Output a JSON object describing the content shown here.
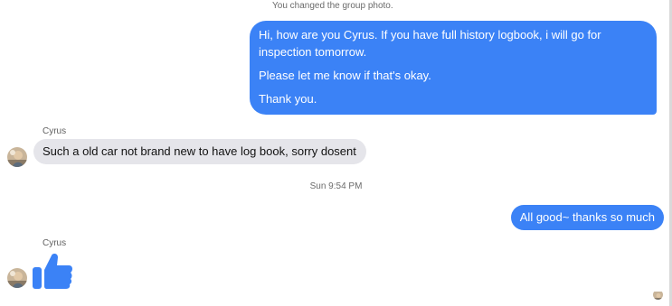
{
  "system_note": "You changed the group photo.",
  "messages": {
    "outgoing_long": [
      "Hi, how are you Cyrus. If you have full history logbook, i will go for inspection tomorrow.",
      "Please let me know if that's okay.",
      "Thank you."
    ],
    "incoming_sender": "Cyrus",
    "incoming_text": "Such a old car not brand new to have log book, sorry dosent",
    "timestamp": "Sun 9:54 PM",
    "outgoing_short": "All good~ thanks so much",
    "incoming_sender_2": "Cyrus",
    "incoming_reaction_icon": "thumbs-up-icon"
  },
  "colors": {
    "outgoing_bubble": "#3b82f6",
    "incoming_bubble": "#e5e5ea",
    "thumbs_up": "#3b82f6"
  }
}
